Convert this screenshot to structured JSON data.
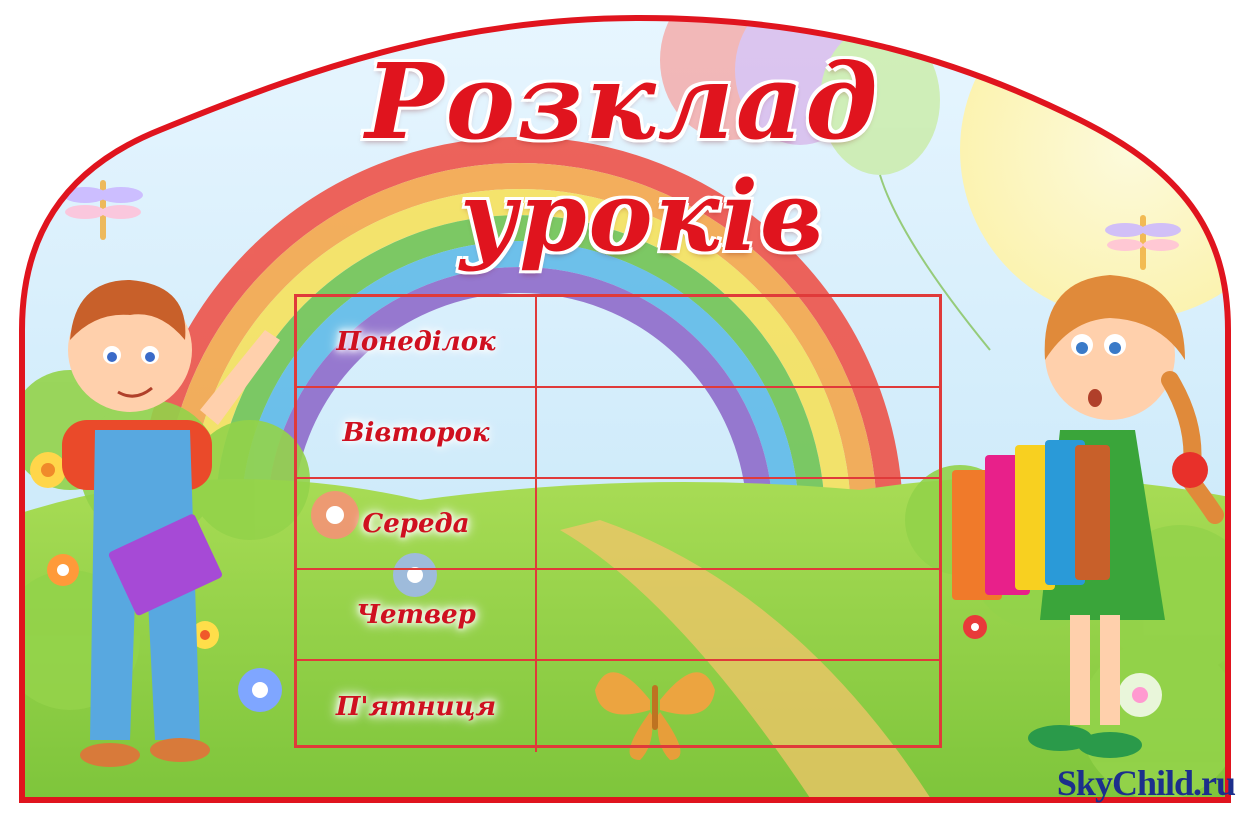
{
  "title": {
    "line1": "Розклад",
    "line2": "уроків"
  },
  "days": [
    {
      "label": "Понеділок"
    },
    {
      "label": "Вівторок"
    },
    {
      "label": "Середа"
    },
    {
      "label": "Четвер"
    },
    {
      "label": "П'ятниця"
    }
  ],
  "watermark": "SkyChild.ru",
  "colors": {
    "frame": "#e0141e",
    "title": "#e0141e",
    "grid": "#e03a3a",
    "sky": "#cfeaf9",
    "grass": "#8fd13a",
    "watermark": "#1c2f8c"
  },
  "icons": [
    "rainbow-icon",
    "balloon-icon",
    "butterfly-icon",
    "dragonfly-icon",
    "flower-icon",
    "boy-with-book-icon",
    "girl-with-books-icon"
  ]
}
